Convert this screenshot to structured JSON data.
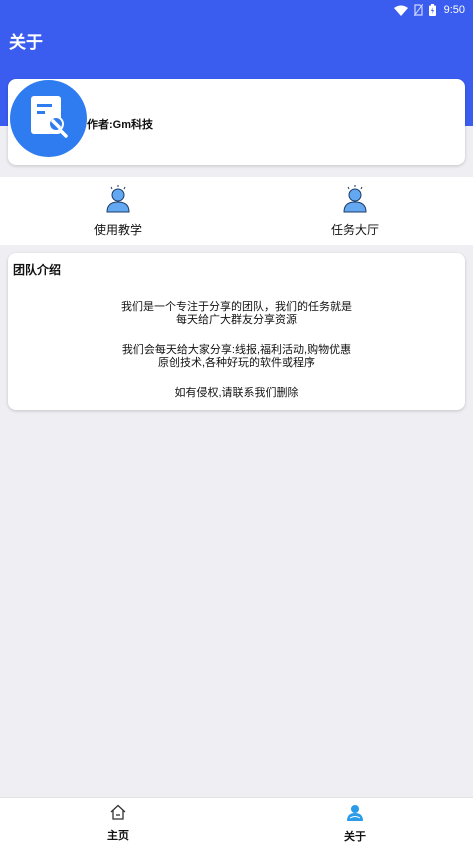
{
  "status_bar": {
    "time": "9:50",
    "icons": [
      "wifi-icon",
      "no-sim-icon",
      "battery-icon"
    ]
  },
  "header": {
    "title": "关于",
    "color": "#3a5df0"
  },
  "profile": {
    "author": "作者:Gm科技",
    "avatar_icon": "document-wrench-icon",
    "avatar_color": "#2f7cf0"
  },
  "quick_actions": [
    {
      "label": "使用教学",
      "icon": "user-icon"
    },
    {
      "label": "任务大厅",
      "icon": "user-icon"
    }
  ],
  "team": {
    "title": "团队介绍",
    "paragraphs": [
      [
        "我们是一个专注于分享的团队，我们的任务就是",
        "每天给广大群友分享资源"
      ],
      [
        "我们会每天给大家分享:线报,福利活动,购物优惠",
        "原创技术,各种好玩的软件或程序"
      ],
      [
        "如有侵权,请联系我们删除"
      ]
    ]
  },
  "bottom_nav": [
    {
      "label": "主页",
      "icon": "home-icon"
    },
    {
      "label": "关于",
      "icon": "user-active-icon",
      "active": true
    }
  ]
}
